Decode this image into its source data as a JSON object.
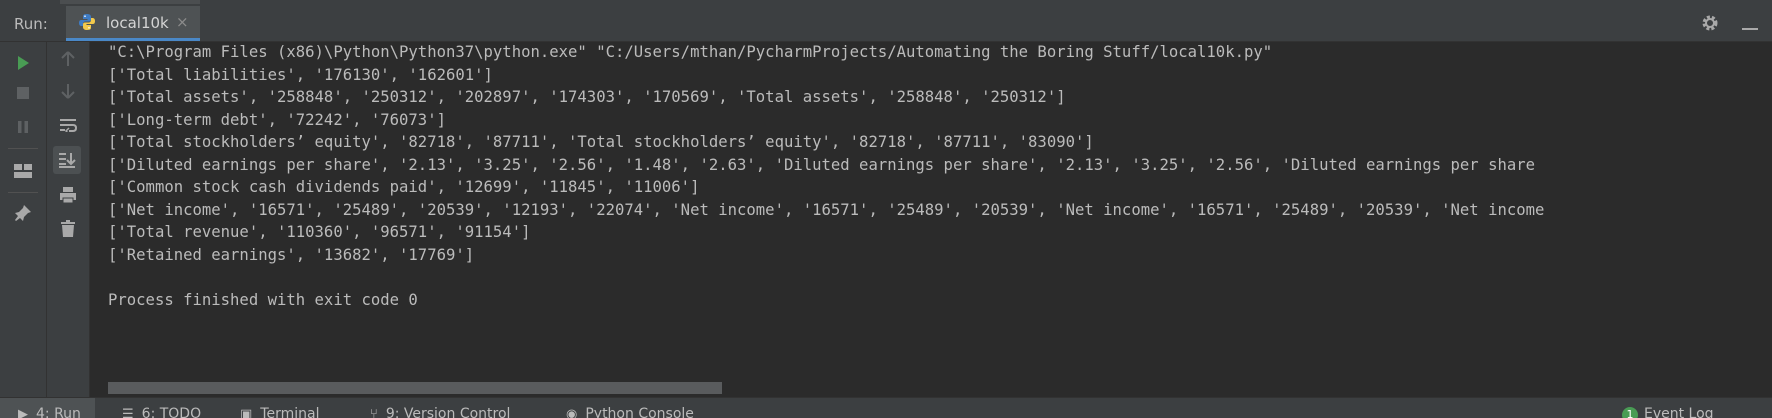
{
  "run_panel": {
    "label": "Run:",
    "tab_label": "local10k",
    "close_glyph": "×"
  },
  "icons": {
    "run": "play-icon",
    "stop": "stop-icon",
    "pause": "pause-icon",
    "layout": "layout-icon",
    "pin": "pin-icon",
    "up": "arrow-up-icon",
    "down": "arrow-down-icon",
    "wrap": "soft-wrap-icon",
    "scroll_end": "scroll-to-end-icon",
    "print": "print-icon",
    "trash": "trash-icon",
    "settings": "gear-icon",
    "minimize": "minimize-icon"
  },
  "colors": {
    "run_green": "#499c54",
    "background": "#2b2b2b",
    "panel": "#3c3f41",
    "text": "#bbbbbb"
  },
  "console": {
    "lines": [
      "\"C:\\Program Files (x86)\\Python\\Python37\\python.exe\" \"C:/Users/mthan/PycharmProjects/Automating the Boring Stuff/local10k.py\"",
      "['Total liabilities', '176130', '162601']",
      "['Total assets', '258848', '250312', '202897', '174303', '170569', 'Total assets', '258848', '250312']",
      "['Long-term debt', '72242', '76073']",
      "['Total stockholders’ equity', '82718', '87711', 'Total stockholders’ equity', '82718', '87711', '83090']",
      "['Diluted earnings per share', '2.13', '3.25', '2.56', '1.48', '2.63', 'Diluted earnings per share', '2.13', '3.25', '2.56', 'Diluted earnings per share",
      "['Common stock cash dividends paid', '12699', '11845', '11006']",
      "['Net income', '16571', '25489', '20539', '12193', '22074', 'Net income', '16571', '25489', '20539', 'Net income', '16571', '25489', '20539', 'Net income",
      "['Total revenue', '110360', '96571', '91154']",
      "['Retained earnings', '13682', '17769']",
      "",
      "Process finished with exit code 0"
    ]
  },
  "bottom_tabs": [
    {
      "label": "4: Run",
      "icon": "▶"
    },
    {
      "label": "6: TODO",
      "icon": "☰"
    },
    {
      "label": "Terminal",
      "icon": "▣"
    },
    {
      "label": "9: Version Control",
      "icon": "⑂"
    },
    {
      "label": "Python Console",
      "icon": "◉"
    }
  ],
  "event_log": {
    "badge": "1",
    "label": "Event Log"
  }
}
